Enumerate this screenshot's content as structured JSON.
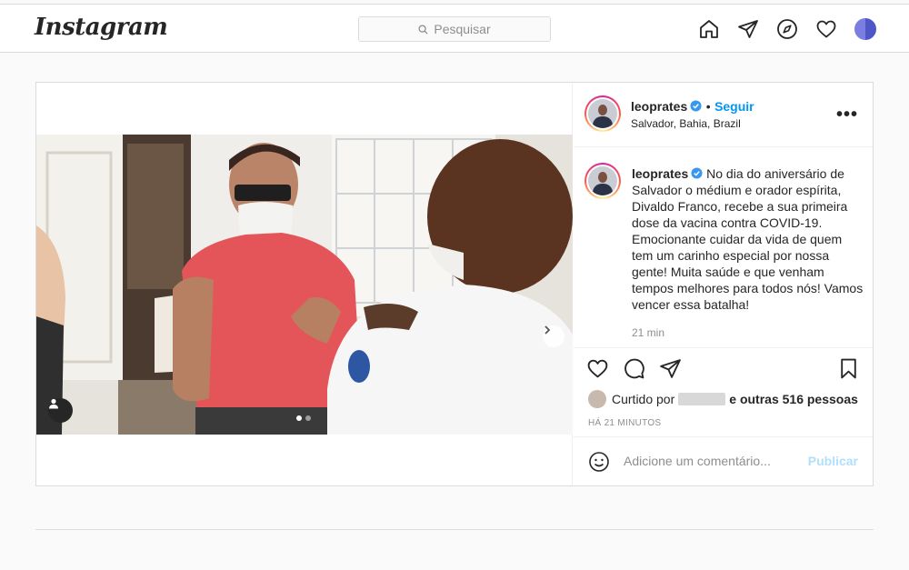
{
  "nav": {
    "logo": "Instagram",
    "search_placeholder": "Pesquisar",
    "icons": [
      "home-icon",
      "direct-icon",
      "explore-icon",
      "activity-heart-icon",
      "profile-avatar"
    ]
  },
  "post": {
    "username": "leoprates",
    "follow_label": "Seguir",
    "separator": "•",
    "location": "Salvador, Bahia, Brazil",
    "more_label": "•••",
    "caption": "No dia do aniversário de Salvador o médium e orador espírita, Divaldo Franco, recebe a sua primeira dose da vacina contra COVID-19. Emocionante cuidar da vida de quem tem um carinho especial por nossa gente! Muita saúde e que venham tempos melhores para todos nós! Vamos vencer essa batalha!",
    "caption_time": "21 min",
    "liked_by_prefix": "Curtido por",
    "liked_by_suffix": "e outras 516 pessoas",
    "date": "HÁ 21 MINUTOS",
    "comment_placeholder": "Adicione um comentário...",
    "publish_label": "Publicar",
    "carousel": {
      "total": 2,
      "current": 1
    }
  },
  "colors": {
    "accent": "#0095f6",
    "publish_disabled": "#b2dffc",
    "border": "#dbdbdb",
    "background": "#fafafa"
  }
}
